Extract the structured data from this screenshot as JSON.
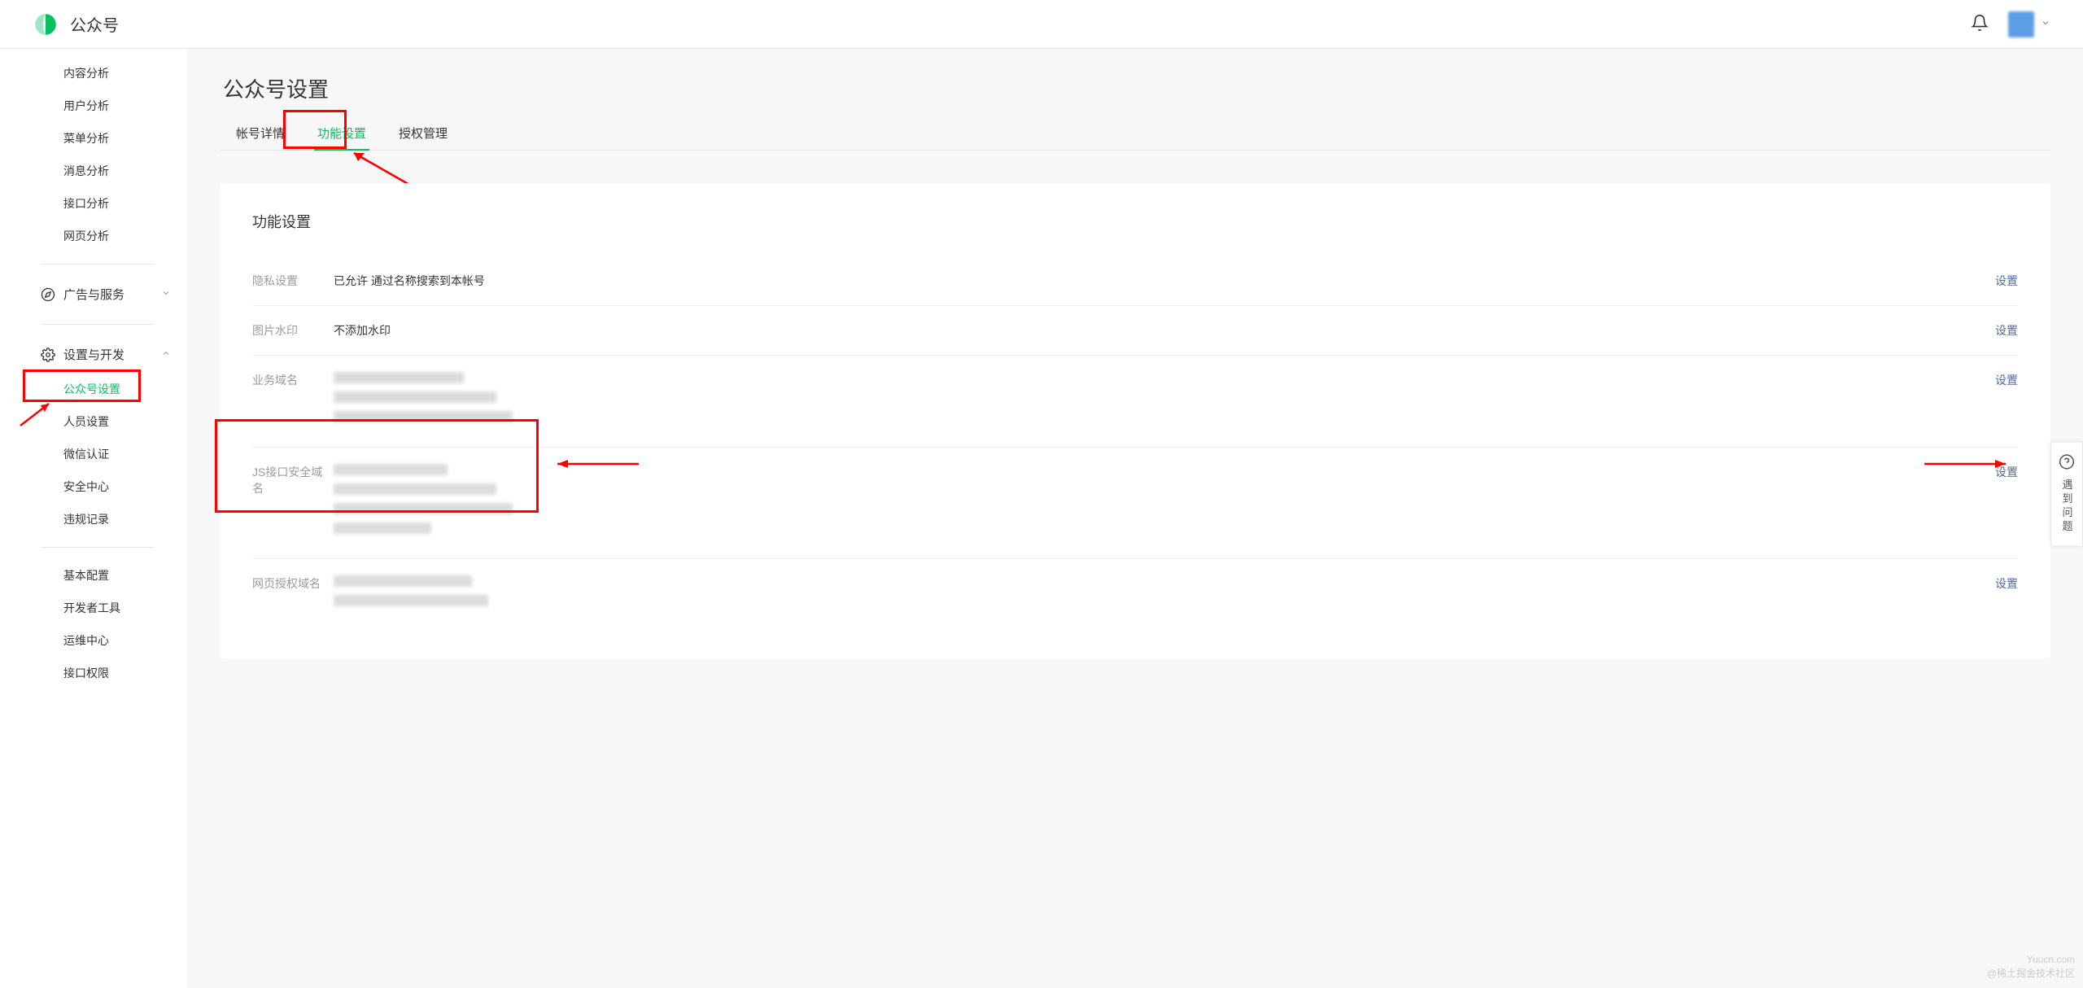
{
  "header": {
    "title": "公众号"
  },
  "sidebar": {
    "items_top": [
      "内容分析",
      "用户分析",
      "菜单分析",
      "消息分析",
      "接口分析",
      "网页分析"
    ],
    "group_ads": {
      "label": "广告与服务"
    },
    "group_dev": {
      "label": "设置与开发"
    },
    "items_dev": [
      "公众号设置",
      "人员设置",
      "微信认证",
      "安全中心",
      "违规记录"
    ],
    "items_dev2": [
      "基本配置",
      "开发者工具",
      "运维中心",
      "接口权限"
    ]
  },
  "page": {
    "title": "公众号设置",
    "tabs": [
      "帐号详情",
      "功能设置",
      "授权管理"
    ],
    "panel_title": "功能设置",
    "settings": {
      "privacy": {
        "label": "隐私设置",
        "value": "已允许 通过名称搜索到本帐号",
        "action": "设置"
      },
      "watermark": {
        "label": "图片水印",
        "value": "不添加水印",
        "action": "设置"
      },
      "biz_domain": {
        "label": "业务域名",
        "action": "设置"
      },
      "js_domain": {
        "label": "JS接口安全域名",
        "action": "设置"
      },
      "web_auth": {
        "label": "网页授权域名",
        "action": "设置"
      }
    }
  },
  "help": {
    "text": "遇到问题"
  },
  "watermark_text1": "Yuucn.com",
  "watermark_text2": "@稀土掘金技术社区"
}
